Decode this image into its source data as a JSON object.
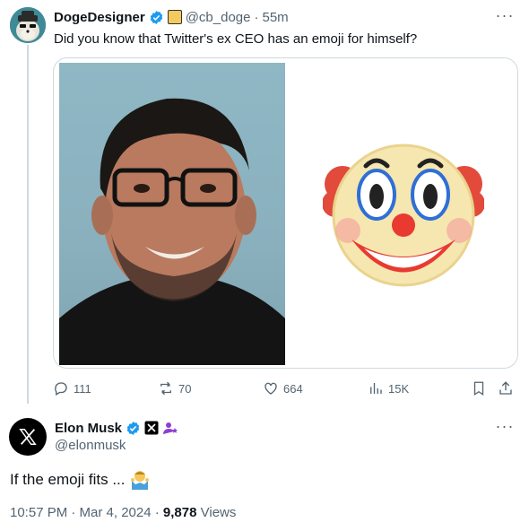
{
  "tweet": {
    "author_name": "DogeDesigner",
    "handle": "@cb_doge",
    "separator": "·",
    "time": "55m",
    "text": "Did you know that Twitter's ex CEO has an emoji for himself?",
    "more_icon": "more-horizontal-icon",
    "media": {
      "left_image": "portrait-photo",
      "right_image": "clown-face-emoji"
    },
    "actions": {
      "replies": "111",
      "reposts": "70",
      "likes": "664",
      "views": "15K"
    }
  },
  "reply": {
    "author_name": "Elon Musk",
    "handle": "@elonmusk",
    "text": "If the emoji fits ...",
    "emoji": "person-shrugging-emoji",
    "timestamp": "10:57 PM · Mar 4, 2024 · ",
    "views_count": "9,878",
    "views_label": " Views"
  },
  "colors": {
    "verified_blue": "#1d9bf0",
    "muted_text": "#536471",
    "border": "#cfd9de",
    "text": "#0f1419"
  }
}
